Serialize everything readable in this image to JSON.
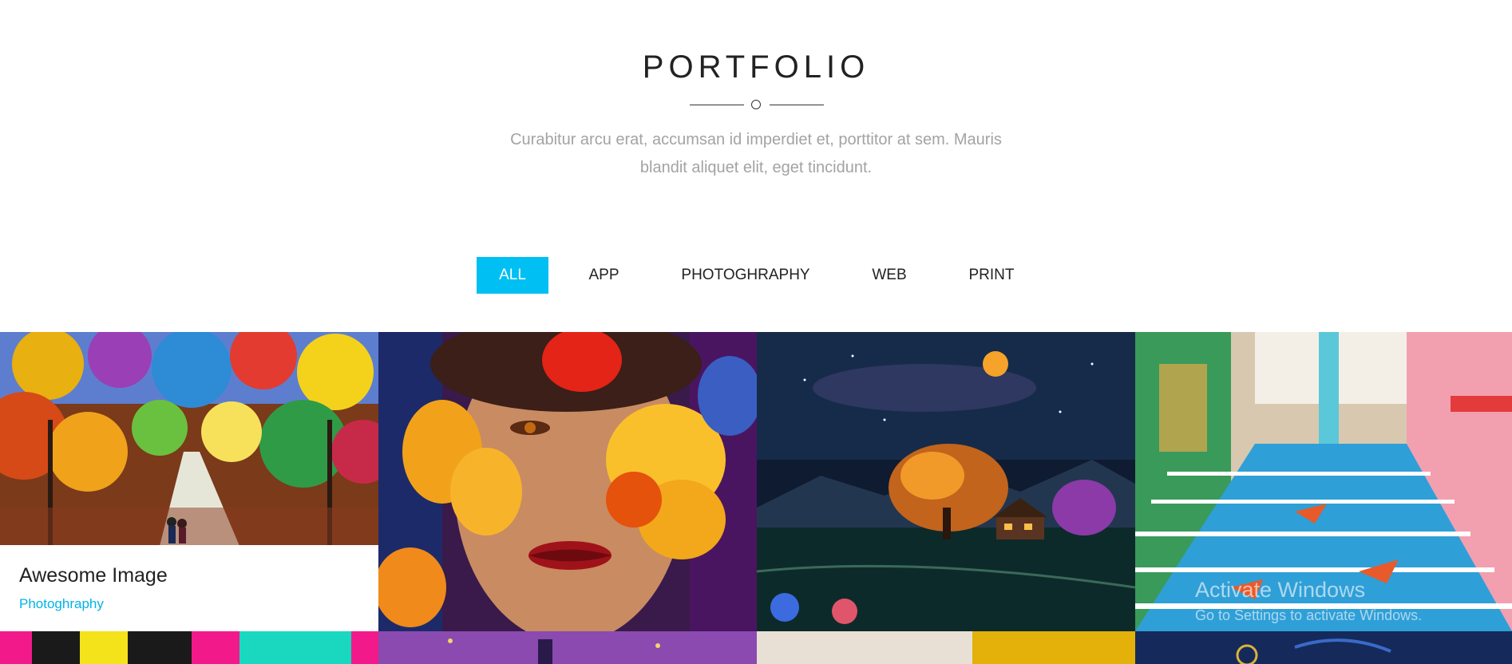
{
  "header": {
    "title": "PORTFOLIO",
    "subtitle_line1": "Curabitur arcu erat, accumsan id imperdiet et, porttitor at sem. Mauris",
    "subtitle_line2": "blandit aliquet elit, eget tincidunt."
  },
  "filters": [
    {
      "label": "ALL",
      "active": true
    },
    {
      "label": "APP",
      "active": false
    },
    {
      "label": "PHOTOGHRAPHY",
      "active": false
    },
    {
      "label": "WEB",
      "active": false
    },
    {
      "label": "PRINT",
      "active": false
    }
  ],
  "portfolio": {
    "items": [
      {
        "title": "Awesome Image",
        "category": "Photoghraphy",
        "image": "autumn-park-painting"
      },
      {
        "image": "woman-with-butterflies-painting"
      },
      {
        "image": "night-landscape-moon-painting"
      },
      {
        "image": "colorful-painted-stairs-photo"
      }
    ],
    "second_row": [
      "pop-art-leaves",
      "purple-city-painting",
      "interior-room",
      "starry-night"
    ]
  },
  "watermark": {
    "title": "Activate Windows",
    "subtitle": "Go to Settings to activate Windows."
  },
  "colors": {
    "accent": "#00bff3",
    "category_text": "#00b4e8",
    "title_text": "#222222",
    "subtitle_text": "#a3a3a3"
  }
}
